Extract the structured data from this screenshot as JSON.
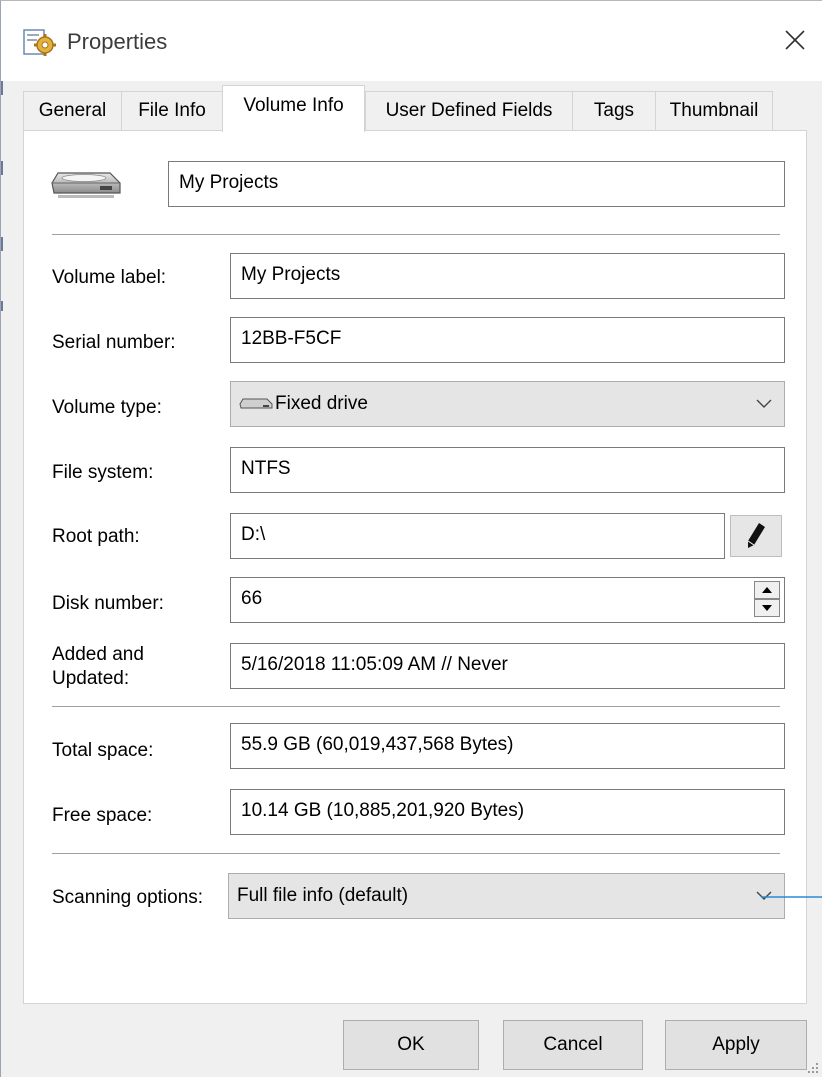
{
  "window": {
    "title": "Properties",
    "close_icon": "close-icon",
    "app_icon": "properties-gear-icon"
  },
  "tabs": [
    {
      "label": "General",
      "active": false
    },
    {
      "label": "File Info",
      "active": false
    },
    {
      "label": "Volume Info",
      "active": true
    },
    {
      "label": "User Defined Fields",
      "active": false
    },
    {
      "label": "Tags",
      "active": false
    },
    {
      "label": "Thumbnail",
      "active": false
    }
  ],
  "volume": {
    "drive_icon": "hard-drive-icon",
    "name_value": "My Projects",
    "volume_label": {
      "label": "Volume label:",
      "value": "My Projects"
    },
    "serial_number": {
      "label": "Serial number:",
      "value": "12BB-F5CF"
    },
    "volume_type": {
      "label": "Volume type:",
      "value": "Fixed drive",
      "icon": "fixed-drive-icon"
    },
    "file_system": {
      "label": "File system:",
      "value": "NTFS"
    },
    "root_path": {
      "label": "Root path:",
      "value": "D:\\",
      "edit_icon": "pencil-icon"
    },
    "disk_number": {
      "label": "Disk number:",
      "value": "66"
    },
    "added_updated": {
      "label_line1": "Added and",
      "label_line2": "Updated:",
      "value": "5/16/2018 11:05:09 AM // Never"
    },
    "total_space": {
      "label": "Total space:",
      "value": "55.9 GB (60,019,437,568 Bytes)"
    },
    "free_space": {
      "label": "Free space:",
      "value": "10.14 GB (10,885,201,920 Bytes)"
    },
    "scanning_options": {
      "label": "Scanning options:",
      "value": "Full file info (default)"
    }
  },
  "buttons": {
    "ok": "OK",
    "cancel": "Cancel",
    "apply": "Apply"
  },
  "colors": {
    "dialog_bg": "#f0f0f0",
    "panel_bg": "#ffffff",
    "field_border": "#7a7a7a",
    "combo_bg": "#e5e5e5",
    "button_bg": "#e1e1e1",
    "pointer_line": "#2a8ad4"
  }
}
